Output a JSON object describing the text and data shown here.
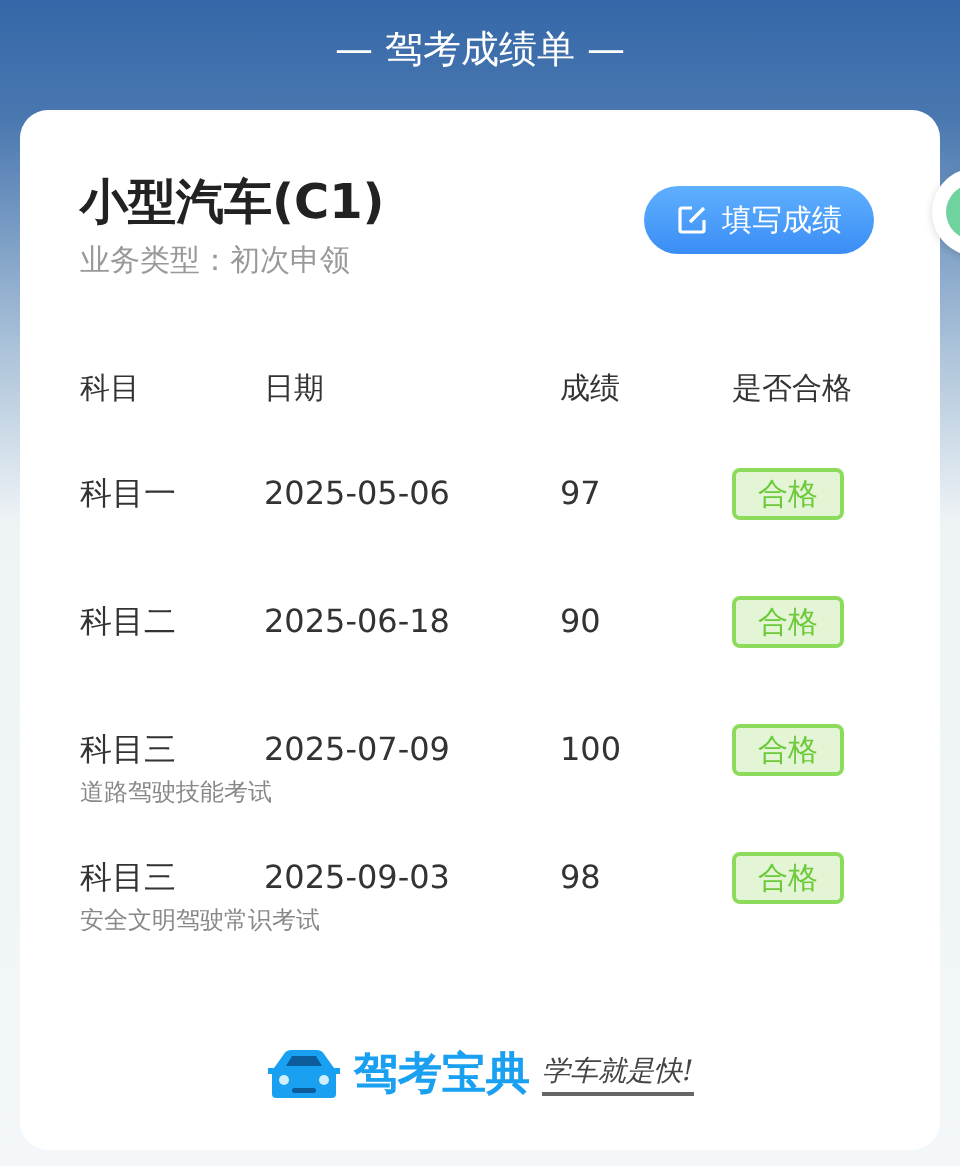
{
  "header": {
    "title": "— 驾考成绩单 —"
  },
  "card": {
    "vehicle": "小型汽车(C1)",
    "business_type": "业务类型：初次申领",
    "fill_button": "填写成绩"
  },
  "table": {
    "columns": [
      "科目",
      "日期",
      "成绩",
      "是否合格"
    ],
    "rows": [
      {
        "subject": "科目一",
        "date": "2025-05-06",
        "score": "97",
        "status": "合格",
        "passed": true
      },
      {
        "subject": "科目二",
        "date": "2025-06-18",
        "score": "90",
        "status": "合格",
        "passed": true
      },
      {
        "subject": "科目三",
        "date": "2025-07-09",
        "score": "100",
        "status": "合格",
        "passed": true,
        "note": "道路驾驶技能考试"
      },
      {
        "subject": "科目三",
        "date": "2025-09-03",
        "score": "98",
        "status": "合格",
        "passed": true,
        "note": "安全文明驾驶常识考试"
      }
    ]
  },
  "footer": {
    "brand": "驾考宝典",
    "slogan": "学车就是快!"
  }
}
